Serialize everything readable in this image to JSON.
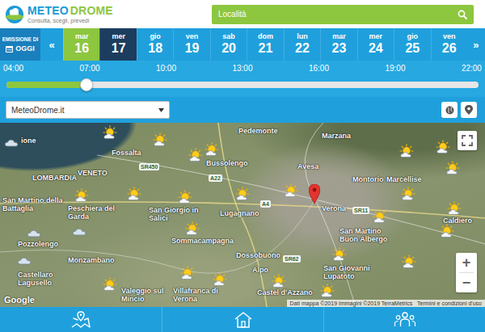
{
  "header": {
    "logo_first": "METEO",
    "logo_second": "DROME",
    "tagline": "Consulta, scegli, prevedi",
    "search_placeholder": "Località"
  },
  "emission": {
    "label": "EMISSIONE DI",
    "value": "OGGI"
  },
  "date_nav": {
    "prev": "«",
    "next": "»"
  },
  "days": [
    {
      "weekday": "mar",
      "day": "16",
      "today": true,
      "selected": false
    },
    {
      "weekday": "mer",
      "day": "17",
      "today": false,
      "selected": true
    },
    {
      "weekday": "gio",
      "day": "18",
      "today": false,
      "selected": false
    },
    {
      "weekday": "ven",
      "day": "19",
      "today": false,
      "selected": false
    },
    {
      "weekday": "sab",
      "day": "20",
      "today": false,
      "selected": false
    },
    {
      "weekday": "dom",
      "day": "21",
      "today": false,
      "selected": false
    },
    {
      "weekday": "lun",
      "day": "22",
      "today": false,
      "selected": false
    },
    {
      "weekday": "mar",
      "day": "23",
      "today": false,
      "selected": false
    },
    {
      "weekday": "mer",
      "day": "24",
      "today": false,
      "selected": false
    },
    {
      "weekday": "gio",
      "day": "25",
      "today": false,
      "selected": false
    },
    {
      "weekday": "ven",
      "day": "26",
      "today": false,
      "selected": false
    }
  ],
  "time_slider": {
    "ticks": [
      "04:00",
      "07:00",
      "10:00",
      "13:00",
      "16:00",
      "19:00",
      "22:00"
    ],
    "level": 0.17
  },
  "source_select": {
    "value": "MeteoDrome.it"
  },
  "map": {
    "labels": [
      "ione",
      "Pedemonte",
      "Marzana",
      "Fossalta",
      "Bussolengo",
      "Avesa",
      "LOMBARDIA",
      "VENETO",
      "Montorio",
      "Marcellise",
      "San Martino della Battaglia",
      "Peschiera del Garda",
      "San Giorgio in Salici",
      "Lugagnano",
      "Verona",
      "Caldiero",
      "San Martino Buon Albergo",
      "Pozzolengo",
      "Sommacampagna",
      "Dossobuono",
      "Monzambano",
      "Alpo",
      "San Giovanni Lupatoto",
      "Castellaro Lagusello",
      "Valeggio sul Mincio",
      "Villafranca di Verona",
      "Castel d'Azzano"
    ],
    "roads": [
      "A22",
      "A4",
      "SR11",
      "SR450",
      "SR62"
    ],
    "markers": [
      {
        "kind": "sun-cloud"
      },
      {
        "kind": "sun-cloud"
      },
      {
        "kind": "sun-cloud"
      },
      {
        "kind": "sun-cloud"
      },
      {
        "kind": "cloud"
      },
      {
        "kind": "sun-cloud"
      },
      {
        "kind": "sun-cloud"
      },
      {
        "kind": "sun-cloud"
      },
      {
        "kind": "sun-cloud"
      },
      {
        "kind": "sun-cloud"
      },
      {
        "kind": "sun-cloud"
      },
      {
        "kind": "sun-cloud"
      },
      {
        "kind": "sun-cloud"
      },
      {
        "kind": "sun-cloud"
      },
      {
        "kind": "sun-cloud"
      },
      {
        "kind": "sun-cloud"
      },
      {
        "kind": "sun-cloud"
      },
      {
        "kind": "cloud"
      },
      {
        "kind": "cloud"
      },
      {
        "kind": "sun-cloud"
      },
      {
        "kind": "sun-cloud"
      },
      {
        "kind": "sun-cloud"
      },
      {
        "kind": "sun-cloud"
      },
      {
        "kind": "cloud"
      },
      {
        "kind": "sun-cloud"
      },
      {
        "kind": "sun-cloud"
      },
      {
        "kind": "sun-cloud"
      },
      {
        "kind": "sun-cloud"
      }
    ],
    "provider": "Google",
    "attribution": "Dati mappa ©2019 Immagini ©2019 TerraMetrics   Termini e condizioni d'uso",
    "zoom_in": "+",
    "zoom_out": "−"
  }
}
